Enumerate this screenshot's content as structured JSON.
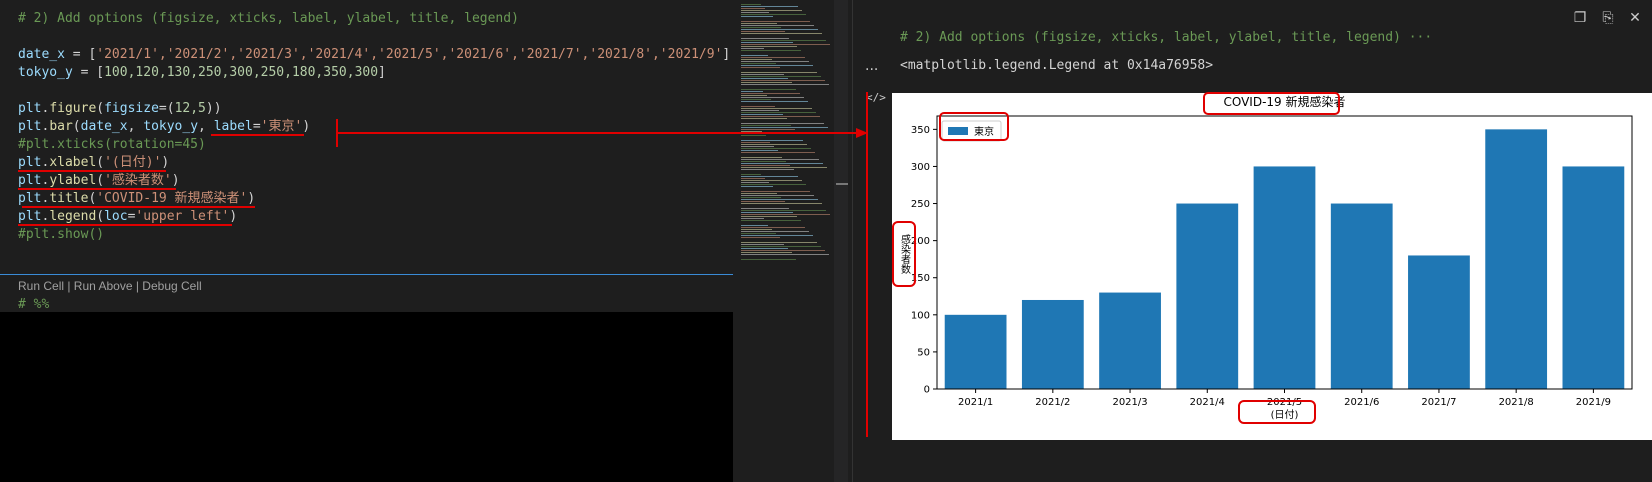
{
  "editor": {
    "lines": {
      "l1": "# 2) Add options (figsize, xticks, label, ylabel, title, legend)",
      "l3a": "date_x",
      "l3b": " = [",
      "l3c": "'2021/1','2021/2','2021/3','2021/4','2021/5','2021/6','2021/7','2021/8','2021/9'",
      "l3d": "]",
      "l4a": "tokyo_y",
      "l4b": " = [",
      "l4c": "100,120,130,250,300,250,180,350,300",
      "l4d": "]",
      "l6a": "plt",
      "l6b": ".",
      "l6c": "figure",
      "l6d": "(",
      "l6e": "figsize",
      "l6f": "=(",
      "l6g": "12,5",
      "l6h": "))",
      "l7a": "plt",
      "l7b": ".",
      "l7c": "bar",
      "l7d": "(",
      "l7e": "date_x",
      "l7f": ", ",
      "l7g": "tokyo_y",
      "l7h": ", ",
      "l7i": "label",
      "l7j": "=",
      "l7k": "'東京'",
      "l7l": ")",
      "l8": "#plt.xticks(rotation=45)",
      "l9a": "plt",
      "l9b": ".",
      "l9c": "xlabel",
      "l9d": "(",
      "l9e": "'(日付)'",
      "l9f": ")",
      "l10a": "plt",
      "l10b": ".",
      "l10c": "ylabel",
      "l10d": "(",
      "l10e": "'感染者数'",
      "l10f": ")",
      "l11a": "plt",
      "l11b": ".",
      "l11c": "title",
      "l11d": "(",
      "l11e": "'COVID-19 新規感染者'",
      "l11f": ")",
      "l12a": "plt",
      "l12b": ".",
      "l12c": "legend",
      "l12d": "(",
      "l12e": "loc",
      "l12f": "=",
      "l12g": "'upper left'",
      "l12h": ")",
      "l13": "#plt.show()"
    },
    "codelens": "Run Cell | Run Above | Debug Cell",
    "next_cell": "# %%"
  },
  "output": {
    "code_echo": "# 2) Add options (figsize, xticks, label, ylabel, title, legend) ···",
    "result": "<matplotlib.legend.Legend at 0x14a76958>",
    "ellipsis": "...",
    "code_tag": "</>"
  },
  "toolbar": {
    "copy_icon": "❐",
    "paste_icon": "⎘",
    "close_icon": "✕"
  },
  "chart_data": {
    "type": "bar",
    "title": "COVID-19 新規感染者",
    "xlabel": "(日付)",
    "ylabel": "感染者数",
    "categories": [
      "2021/1",
      "2021/2",
      "2021/3",
      "2021/4",
      "2021/5",
      "2021/6",
      "2021/7",
      "2021/8",
      "2021/9"
    ],
    "series": [
      {
        "name": "東京",
        "values": [
          100,
          120,
          130,
          250,
          300,
          250,
          180,
          350,
          300
        ],
        "color": "#1f77b4"
      }
    ],
    "ylim": [
      0,
      368
    ],
    "yticks": [
      0,
      50,
      100,
      150,
      200,
      250,
      300,
      350
    ],
    "legend": "upper-left",
    "grid": false
  },
  "colors": {
    "annotation": "#e00000",
    "bar": "#1f77b4",
    "editor_bg": "#1e1e1e"
  }
}
